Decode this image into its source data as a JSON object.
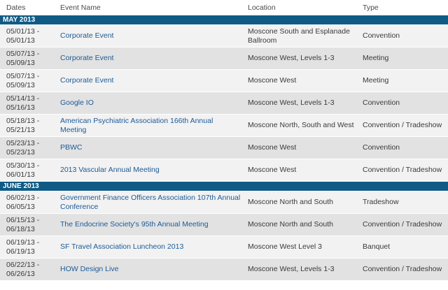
{
  "headers": {
    "dates": "Dates",
    "name": "Event Name",
    "location": "Location",
    "type": "Type"
  },
  "months": [
    {
      "label": "MAY 2013",
      "events": [
        {
          "date": "05/01/13 -\n05/01/13",
          "name": "Corporate Event",
          "location": "Moscone South and Esplanade Ballroom",
          "type": "Convention"
        },
        {
          "date": "05/07/13 -\n05/09/13",
          "name": "Corporate Event",
          "location": "Moscone West, Levels 1-3",
          "type": "Meeting"
        },
        {
          "date": "05/07/13 -\n05/09/13",
          "name": "Corporate Event",
          "location": "Moscone West",
          "type": "Meeting"
        },
        {
          "date": "05/14/13 -\n05/16/13",
          "name": "Google IO",
          "location": "Moscone West, Levels 1-3",
          "type": "Convention"
        },
        {
          "date": "05/18/13 -\n05/21/13",
          "name": "American Psychiatric Association 166th Annual Meeting",
          "location": "Moscone North, South and West",
          "type": "Convention / Tradeshow"
        },
        {
          "date": "05/23/13 -\n05/23/13",
          "name": "PBWC",
          "location": "Moscone West",
          "type": "Convention"
        },
        {
          "date": "05/30/13 -\n06/01/13",
          "name": "2013 Vascular Annual Meeting",
          "location": "Moscone West",
          "type": "Convention / Tradeshow"
        }
      ]
    },
    {
      "label": "JUNE 2013",
      "events": [
        {
          "date": "06/02/13 -\n06/05/13",
          "name": "Government Finance Officers Association 107th Annual Conference",
          "location": "Moscone North and South",
          "type": "Tradeshow"
        },
        {
          "date": "06/15/13 -\n06/18/13",
          "name": "The Endocrine Society's 95th Annual Meeting",
          "location": "Moscone North and South",
          "type": "Convention / Tradeshow"
        },
        {
          "date": "06/19/13 -\n06/19/13",
          "name": "SF Travel Association Luncheon 2013",
          "location": "Moscone West Level 3",
          "type": "Banquet"
        },
        {
          "date": "06/22/13 -\n06/26/13",
          "name": "HOW Design Live",
          "location": "Moscone West, Levels 1-3",
          "type": "Convention / Tradeshow"
        }
      ]
    }
  ]
}
